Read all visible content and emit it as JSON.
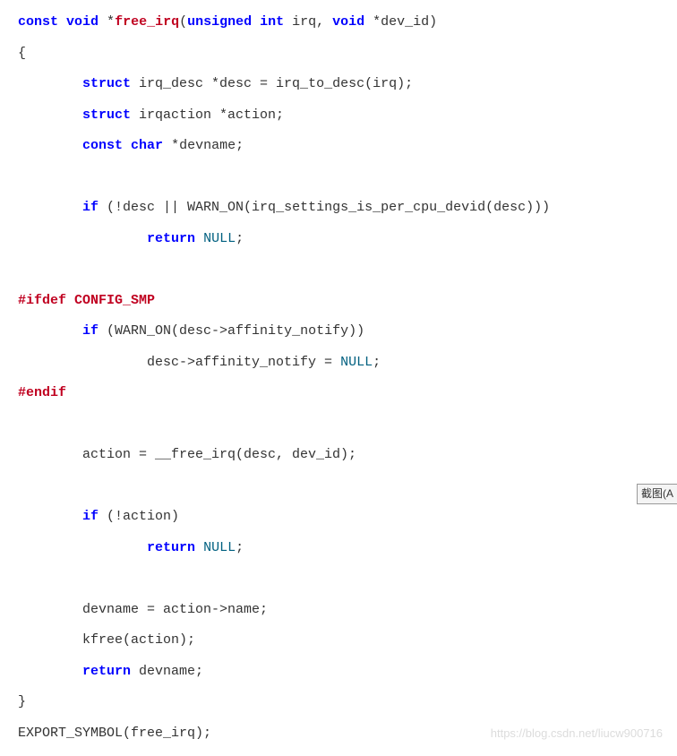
{
  "code": {
    "l1": {
      "a": "const",
      "b": "void",
      "c": " *",
      "d": "free_irq",
      "e": "(",
      "f": "unsigned",
      "g": " ",
      "h": "int",
      "i": " irq, ",
      "j": "void",
      "k": " *dev_id)"
    },
    "l2": "{",
    "l3": {
      "a": "        ",
      "b": "struct",
      "c": " irq_desc *desc = irq_to_desc(irq);"
    },
    "l4": {
      "a": "        ",
      "b": "struct",
      "c": " irqaction *action;"
    },
    "l5": {
      "a": "        ",
      "b": "const",
      "c": " ",
      "d": "char",
      "e": " *devname;"
    },
    "l6": "",
    "l7": {
      "a": "        ",
      "b": "if",
      "c": " (!desc || WARN_ON(irq_settings_is_per_cpu_devid(desc)))"
    },
    "l8": {
      "a": "                ",
      "b": "return",
      "c": " ",
      "d": "NULL",
      "e": ";"
    },
    "l9": "",
    "l10": "#ifdef CONFIG_SMP",
    "l11": {
      "a": "        ",
      "b": "if",
      "c": " (WARN_ON(desc->affinity_notify))"
    },
    "l12": {
      "a": "                desc->affinity_notify = ",
      "b": "NULL",
      "c": ";"
    },
    "l13": "#endif",
    "l14": "",
    "l15": "        action = __free_irq(desc, dev_id);",
    "l16": "",
    "l17": {
      "a": "        ",
      "b": "if",
      "c": " (!action)"
    },
    "l18": {
      "a": "                ",
      "b": "return",
      "c": " ",
      "d": "NULL",
      "e": ";"
    },
    "l19": "",
    "l20": "        devname = action->name;",
    "l21": "        kfree(action);",
    "l22": {
      "a": "        ",
      "b": "return",
      "c": " devname;"
    },
    "l23": "}",
    "l24": "EXPORT_SYMBOL(free_irq);"
  },
  "watermark": "https://blog.csdn.net/liucw900716",
  "sideTab": "截图(A"
}
